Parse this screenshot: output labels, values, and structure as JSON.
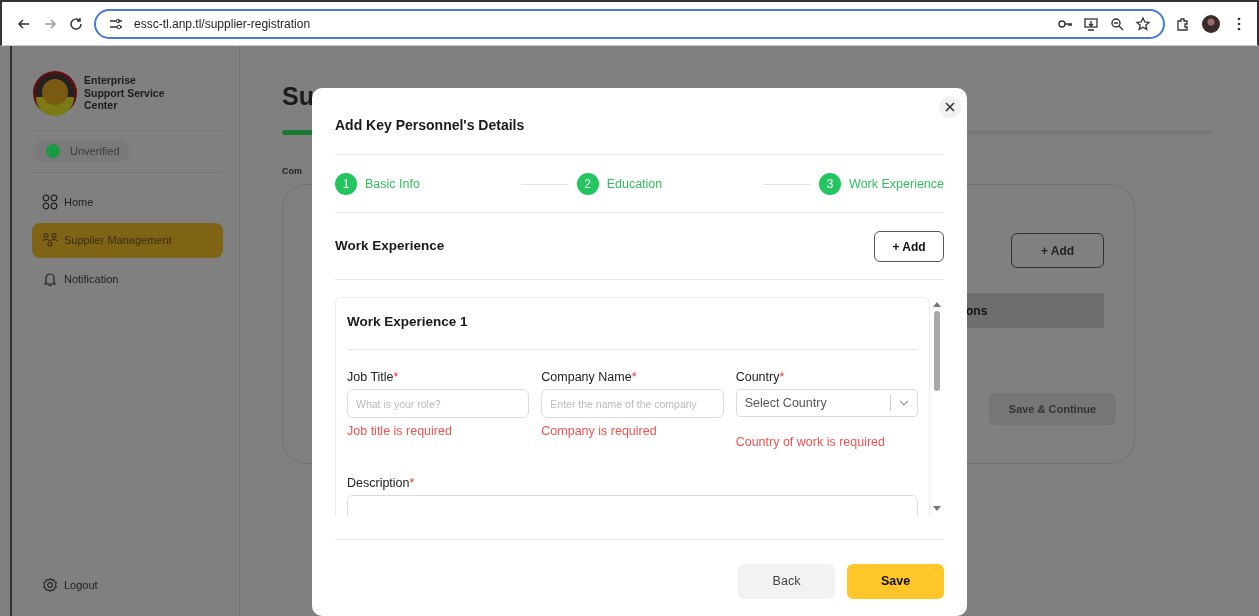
{
  "browser": {
    "url": "essc-tl.anp.tl/supplier-registration"
  },
  "sidebar": {
    "brand": "Enterprise Support Service Center",
    "status": {
      "label": "Unverified",
      "on": true
    },
    "items": [
      {
        "label": "Home",
        "kind": "grid",
        "selected": false
      },
      {
        "label": "Supplier Management",
        "kind": "people",
        "selected": true
      },
      {
        "label": "Notification",
        "kind": "bell",
        "selected": false
      }
    ],
    "logout": "Logout"
  },
  "page": {
    "title": "Su",
    "progress": {
      "level": 0.33
    },
    "tab": "Com",
    "add_button": "+ Add",
    "table_header": "ons",
    "save_button": "Save & Continue"
  },
  "modal": {
    "title": "Add Key Personnel's Details",
    "steps": [
      {
        "number": "1",
        "label": "Basic Info",
        "done": true
      },
      {
        "number": "2",
        "label": "Education",
        "done": true
      },
      {
        "number": "3",
        "label": "Work Experience",
        "done": true
      }
    ],
    "section_title": "Work Experience",
    "add_button": "+ Add",
    "entry": {
      "title": "Work Experience 1",
      "fields": [
        {
          "kind": "text",
          "label": "Job Title",
          "mark": "*",
          "placeholder": "What is your role?",
          "error": "Job title is required"
        },
        {
          "kind": "text",
          "label": "Company Name",
          "mark": "*",
          "placeholder": "Enter the name of the company",
          "error": "Company is required"
        },
        {
          "kind": "select",
          "label": "Country",
          "mark": "*",
          "value": "Select Country",
          "error": "Country of work is required"
        },
        {
          "kind": "textarea",
          "label": "Description",
          "mark": "*"
        }
      ]
    },
    "buttons": [
      {
        "label": "Back",
        "kind": "secondary"
      },
      {
        "label": "Save",
        "kind": "primary"
      }
    ]
  }
}
